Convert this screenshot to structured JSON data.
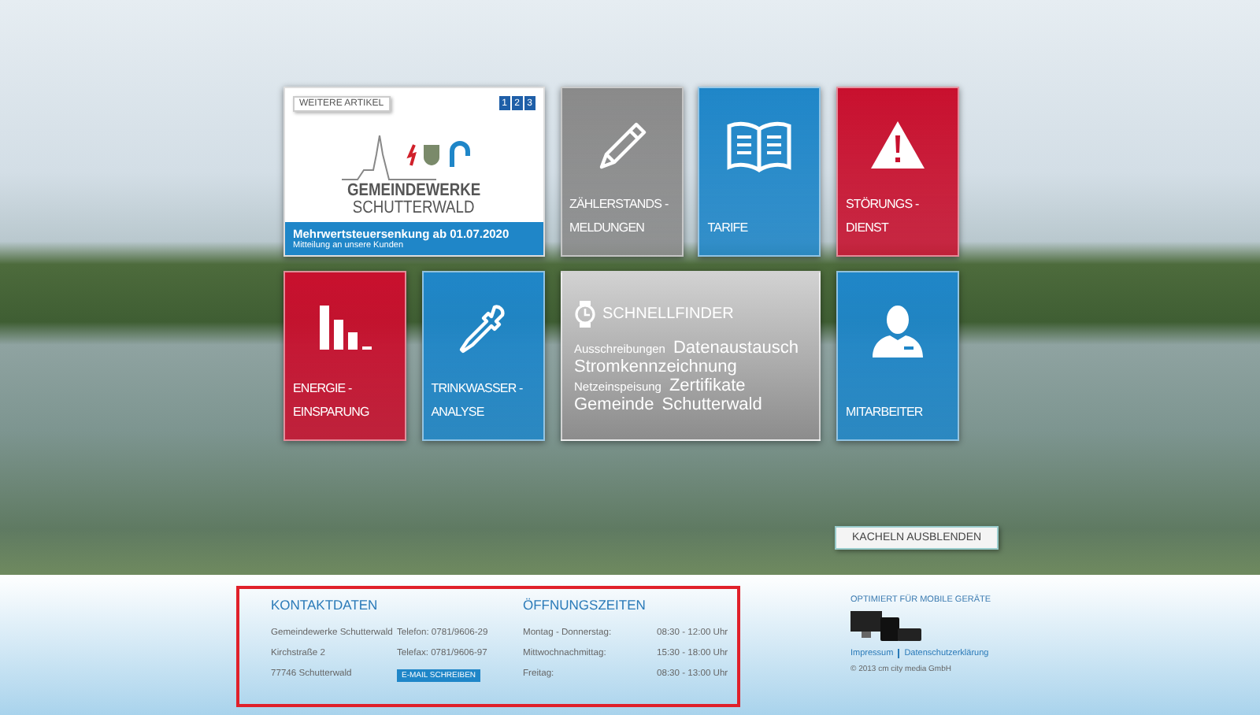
{
  "news_tile": {
    "tag": "WEITERE ARTIKEL",
    "pages": [
      "1",
      "2",
      "3"
    ],
    "logo_line_1": "GEMEINDEWERKE",
    "logo_line_2": "SCHUTTERWALD",
    "headline": "Mehrwertsteuersenkung ab 01.07.2020",
    "subline": "Mitteilung an unsere Kunden"
  },
  "tiles_row_1": [
    {
      "kind": "readings",
      "color": "#8a8a8a",
      "lines": [
        "ZÄHLERSTANDS -",
        "MELDUNGEN"
      ]
    },
    {
      "kind": "tariffs",
      "color": "#1f86c8",
      "lines": [
        "TARIFE"
      ]
    },
    {
      "kind": "fault",
      "color": "#c8102e",
      "lines": [
        "STÖRUNGS -",
        "DIENST"
      ]
    }
  ],
  "tiles_row_2": [
    {
      "kind": "energy",
      "color": "#c8102e",
      "lines": [
        "ENERGIE -",
        "EINSPARUNG"
      ]
    },
    {
      "kind": "water",
      "color": "#1f86c8",
      "lines": [
        "TRINKWASSER -",
        "ANALYSE"
      ]
    }
  ],
  "quickfinder": {
    "title": "SCHNELLFINDER",
    "links": [
      {
        "text": "Ausschreibungen",
        "kind": "minor"
      },
      {
        "text": "Datenaustausch",
        "kind": "major"
      },
      {
        "text": "Stromkennzeichnung",
        "kind": "major"
      },
      {
        "text": "Netzeinspeisung",
        "kind": "minor"
      },
      {
        "text": "Zertifikate",
        "kind": "major"
      },
      {
        "text": "Gemeinde",
        "kind": "major"
      },
      {
        "text": "Schutterwald",
        "kind": "major"
      }
    ]
  },
  "staff_tile": {
    "kind": "staff",
    "color": "#1f86c8",
    "lines": [
      "MITARBEITER"
    ]
  },
  "hide_tiles_button": "KACHELN AUSBLENDEN",
  "contact": {
    "title": "KONTAKTDATEN",
    "rows": [
      {
        "left": "Gemeindewerke Schutterwald",
        "right": "Telefon: 0781/9606-29",
        "kind": "text"
      },
      {
        "left": "Kirchstraße 2",
        "right": "Telefax: 0781/9606-97",
        "kind": "text"
      },
      {
        "left": "77746 Schutterwald",
        "right": "E-MAIL SCHREIBEN",
        "kind": "button"
      }
    ]
  },
  "hours": {
    "title": "ÖFFNUNGSZEITEN",
    "rows": [
      {
        "day": "Montag - Donnerstag:",
        "time": "08:30 - 12:00 Uhr"
      },
      {
        "day": "Mittwochnachmittag:",
        "time": "15:30 - 18:00 Uhr"
      },
      {
        "day": "Freitag:",
        "time": "08:30 - 13:00 Uhr"
      }
    ]
  },
  "mobile": {
    "title": "OPTIMIERT FÜR MOBILE GERÄTE",
    "links": [
      "Impressum",
      "Datenschutzerklärung"
    ],
    "copyright": "© 2013 cm city media GmbH"
  }
}
